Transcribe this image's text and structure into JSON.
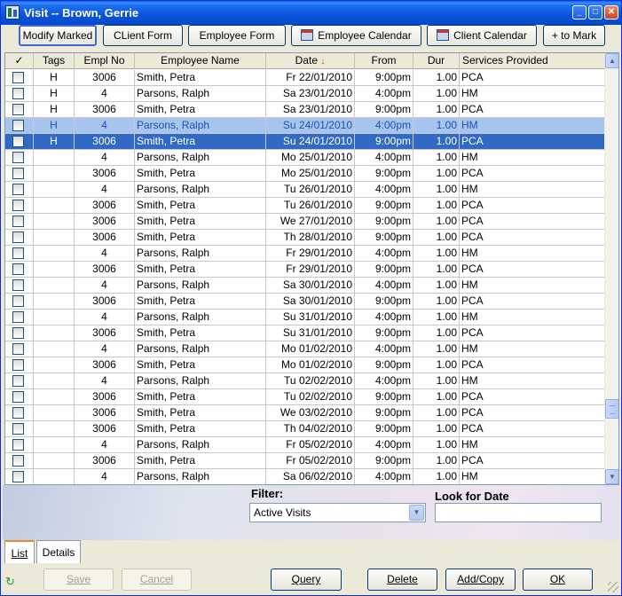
{
  "window": {
    "title": "Visit  -- Brown, Gerrie"
  },
  "toolbar": {
    "modify_marked": "Modify Marked",
    "client_form": "CLient Form",
    "employee_form": "Employee Form",
    "employee_calendar": "Employee Calendar",
    "client_calendar": "Client Calendar",
    "to_mark": "+ to Mark"
  },
  "grid": {
    "columns": [
      "✓",
      "Tags",
      "Empl No",
      "Employee Name",
      "Date",
      "From",
      "Dur",
      "Services Provided"
    ],
    "rows": [
      {
        "tag": "H",
        "empl": "3006",
        "name": "Smith, Petra",
        "date": "Fr 22/01/2010",
        "from": "9:00pm",
        "dur": "1.00",
        "svc": "PCA"
      },
      {
        "tag": "H",
        "empl": "4",
        "name": "Parsons, Ralph",
        "date": "Sa 23/01/2010",
        "from": "4:00pm",
        "dur": "1.00",
        "svc": "HM"
      },
      {
        "tag": "H",
        "empl": "3006",
        "name": "Smith, Petra",
        "date": "Sa 23/01/2010",
        "from": "9:00pm",
        "dur": "1.00",
        "svc": "PCA"
      },
      {
        "tag": "H",
        "empl": "4",
        "name": "Parsons, Ralph",
        "date": "Su 24/01/2010",
        "from": "4:00pm",
        "dur": "1.00",
        "svc": "HM"
      },
      {
        "tag": "H",
        "empl": "3006",
        "name": "Smith, Petra",
        "date": "Su 24/01/2010",
        "from": "9:00pm",
        "dur": "1.00",
        "svc": "PCA"
      },
      {
        "tag": "",
        "empl": "4",
        "name": "Parsons, Ralph",
        "date": "Mo 25/01/2010",
        "from": "4:00pm",
        "dur": "1.00",
        "svc": "HM"
      },
      {
        "tag": "",
        "empl": "3006",
        "name": "Smith, Petra",
        "date": "Mo 25/01/2010",
        "from": "9:00pm",
        "dur": "1.00",
        "svc": "PCA"
      },
      {
        "tag": "",
        "empl": "4",
        "name": "Parsons, Ralph",
        "date": "Tu 26/01/2010",
        "from": "4:00pm",
        "dur": "1.00",
        "svc": "HM"
      },
      {
        "tag": "",
        "empl": "3006",
        "name": "Smith, Petra",
        "date": "Tu 26/01/2010",
        "from": "9:00pm",
        "dur": "1.00",
        "svc": "PCA"
      },
      {
        "tag": "",
        "empl": "3006",
        "name": "Smith, Petra",
        "date": "We 27/01/2010",
        "from": "9:00pm",
        "dur": "1.00",
        "svc": "PCA"
      },
      {
        "tag": "",
        "empl": "3006",
        "name": "Smith, Petra",
        "date": "Th 28/01/2010",
        "from": "9:00pm",
        "dur": "1.00",
        "svc": "PCA"
      },
      {
        "tag": "",
        "empl": "4",
        "name": "Parsons, Ralph",
        "date": "Fr 29/01/2010",
        "from": "4:00pm",
        "dur": "1.00",
        "svc": "HM"
      },
      {
        "tag": "",
        "empl": "3006",
        "name": "Smith, Petra",
        "date": "Fr 29/01/2010",
        "from": "9:00pm",
        "dur": "1.00",
        "svc": "PCA"
      },
      {
        "tag": "",
        "empl": "4",
        "name": "Parsons, Ralph",
        "date": "Sa 30/01/2010",
        "from": "4:00pm",
        "dur": "1.00",
        "svc": "HM"
      },
      {
        "tag": "",
        "empl": "3006",
        "name": "Smith, Petra",
        "date": "Sa 30/01/2010",
        "from": "9:00pm",
        "dur": "1.00",
        "svc": "PCA"
      },
      {
        "tag": "",
        "empl": "4",
        "name": "Parsons, Ralph",
        "date": "Su 31/01/2010",
        "from": "4:00pm",
        "dur": "1.00",
        "svc": "HM"
      },
      {
        "tag": "",
        "empl": "3006",
        "name": "Smith, Petra",
        "date": "Su 31/01/2010",
        "from": "9:00pm",
        "dur": "1.00",
        "svc": "PCA"
      },
      {
        "tag": "",
        "empl": "4",
        "name": "Parsons, Ralph",
        "date": "Mo 01/02/2010",
        "from": "4:00pm",
        "dur": "1.00",
        "svc": "HM"
      },
      {
        "tag": "",
        "empl": "3006",
        "name": "Smith, Petra",
        "date": "Mo 01/02/2010",
        "from": "9:00pm",
        "dur": "1.00",
        "svc": "PCA"
      },
      {
        "tag": "",
        "empl": "4",
        "name": "Parsons, Ralph",
        "date": "Tu 02/02/2010",
        "from": "4:00pm",
        "dur": "1.00",
        "svc": "HM"
      },
      {
        "tag": "",
        "empl": "3006",
        "name": "Smith, Petra",
        "date": "Tu 02/02/2010",
        "from": "9:00pm",
        "dur": "1.00",
        "svc": "PCA"
      },
      {
        "tag": "",
        "empl": "3006",
        "name": "Smith, Petra",
        "date": "We 03/02/2010",
        "from": "9:00pm",
        "dur": "1.00",
        "svc": "PCA"
      },
      {
        "tag": "",
        "empl": "3006",
        "name": "Smith, Petra",
        "date": "Th 04/02/2010",
        "from": "9:00pm",
        "dur": "1.00",
        "svc": "PCA"
      },
      {
        "tag": "",
        "empl": "4",
        "name": "Parsons, Ralph",
        "date": "Fr 05/02/2010",
        "from": "4:00pm",
        "dur": "1.00",
        "svc": "HM"
      },
      {
        "tag": "",
        "empl": "3006",
        "name": "Smith, Petra",
        "date": "Fr 05/02/2010",
        "from": "9:00pm",
        "dur": "1.00",
        "svc": "PCA"
      },
      {
        "tag": "",
        "empl": "4",
        "name": "Parsons, Ralph",
        "date": "Sa 06/02/2010",
        "from": "4:00pm",
        "dur": "1.00",
        "svc": "HM"
      }
    ],
    "selected_row_light": 3,
    "selected_row_dark": 4
  },
  "filter": {
    "label": "Filter:",
    "value": "Active Visits"
  },
  "look_for_date": {
    "label": "Look for Date",
    "value": ""
  },
  "tabs": [
    "List",
    "Details"
  ],
  "buttons": {
    "save": "Save",
    "cancel": "Cancel",
    "query": "Query",
    "delete": "Delete",
    "add_copy": "Add/Copy",
    "ok": "OK"
  },
  "colors": {
    "title_bar": "#0a54dc",
    "selection": "#316ac5",
    "selection_light": "#a6c4ec"
  }
}
